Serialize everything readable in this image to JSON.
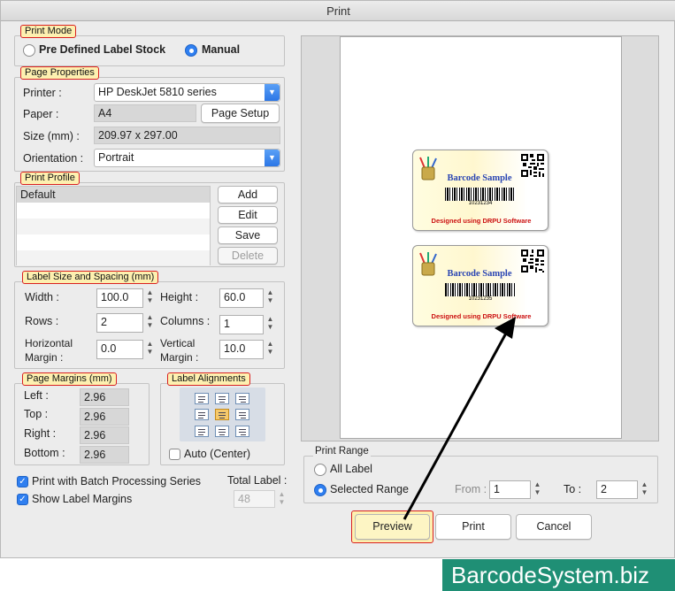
{
  "window": {
    "title": "Print"
  },
  "print_mode": {
    "legend": "Print Mode",
    "options": [
      "Pre Defined Label Stock",
      "Manual"
    ],
    "selected": "Manual"
  },
  "page_properties": {
    "legend": "Page Properties",
    "printer_label": "Printer :",
    "printer_value": "HP DeskJet 5810 series",
    "paper_label": "Paper :",
    "paper_value": "A4",
    "page_setup_button": "Page Setup",
    "size_label": "Size (mm) :",
    "size_value": "209.97 x 297.00",
    "orientation_label": "Orientation :",
    "orientation_value": "Portrait"
  },
  "print_profile": {
    "legend": "Print Profile",
    "items": [
      "Default"
    ],
    "buttons": {
      "add": "Add",
      "edit": "Edit",
      "save": "Save",
      "delete": "Delete"
    }
  },
  "label_size": {
    "legend": "Label Size and Spacing (mm)",
    "width_label": "Width :",
    "width_value": "100.0",
    "height_label": "Height :",
    "height_value": "60.0",
    "rows_label": "Rows :",
    "rows_value": "2",
    "columns_label": "Columns :",
    "columns_value": "1",
    "hmargin_label_1": "Horizontal",
    "hmargin_label_2": "Margin :",
    "hmargin_value": "0.0",
    "vmargin_label_1": "Vertical",
    "vmargin_label_2": "Margin :",
    "vmargin_value": "10.0"
  },
  "page_margins": {
    "legend": "Page Margins (mm)",
    "left_label": "Left :",
    "left_value": "2.96",
    "top_label": "Top :",
    "top_value": "2.96",
    "right_label": "Right :",
    "right_value": "2.96",
    "bottom_label": "Bottom :",
    "bottom_value": "2.96"
  },
  "label_alignments": {
    "legend": "Label Alignments",
    "selected": "middle-center",
    "auto_center_label": "Auto (Center)",
    "auto_center_checked": false
  },
  "options": {
    "batch_label": "Print with Batch Processing Series",
    "batch_checked": true,
    "margins_label": "Show Label Margins",
    "margins_checked": true,
    "total_label_caption": "Total Label :",
    "total_label_value": "48"
  },
  "preview": {
    "labels": [
      {
        "title": "Barcode Sample",
        "number": "10231234",
        "footer": "Designed using DRPU Software"
      },
      {
        "title": "Barcode Sample",
        "number": "10231235",
        "footer": "Designed using DRPU Software"
      }
    ]
  },
  "print_range": {
    "legend": "Print Range",
    "all_label": "All Label",
    "selected_label": "Selected Range",
    "selected": "Selected Range",
    "from_label": "From :",
    "from_value": "1",
    "to_label": "To :",
    "to_value": "2"
  },
  "buttons": {
    "preview": "Preview",
    "print": "Print",
    "cancel": "Cancel"
  },
  "watermark": {
    "text": "BarcodeSystem.biz",
    "bg_color": "#1f8f75"
  },
  "colors": {
    "accent": "#2f7ff0",
    "tag_bg": "#fdf0b0",
    "tag_border": "#d92020"
  }
}
